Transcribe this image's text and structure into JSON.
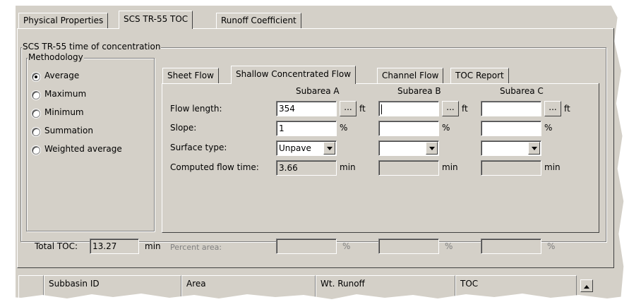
{
  "top_tabs": [
    "Physical Properties",
    "SCS TR-55 TOC",
    "Runoff Coefficient"
  ],
  "section_title": "SCS TR-55 time of concentration",
  "methodology": {
    "label": "Methodology",
    "options": [
      "Average",
      "Maximum",
      "Minimum",
      "Summation",
      "Weighted average"
    ],
    "selected": "Average"
  },
  "inner_tabs": [
    "Sheet Flow",
    "Shallow Concentrated Flow",
    "Channel Flow",
    "TOC Report"
  ],
  "subareas": [
    "Subarea A",
    "Subarea B",
    "Subarea C"
  ],
  "row_labels": {
    "flow_length": "Flow length:",
    "slope": "Slope:",
    "surface_type": "Surface type:",
    "computed_flow_time": "Computed flow time:",
    "percent_area": "Percent area:"
  },
  "units": {
    "length": "ft",
    "slope": "%",
    "time": "min",
    "percent": "%"
  },
  "browse_label": "...",
  "values": {
    "a": {
      "flow_length": "354",
      "slope": "1",
      "surface_type": "Unpave",
      "flow_time": "3.66",
      "percent_area": ""
    },
    "b": {
      "flow_length": "",
      "slope": "",
      "surface_type": "",
      "flow_time": "",
      "percent_area": ""
    },
    "c": {
      "flow_length": "",
      "slope": "",
      "surface_type": "",
      "flow_time": "",
      "percent_area": ""
    }
  },
  "total_toc": {
    "label": "Total TOC:",
    "value": "13.27",
    "unit": "min"
  },
  "grid_columns": [
    "Subbasin ID",
    "Area",
    "Wt. Runoff",
    "TOC"
  ]
}
